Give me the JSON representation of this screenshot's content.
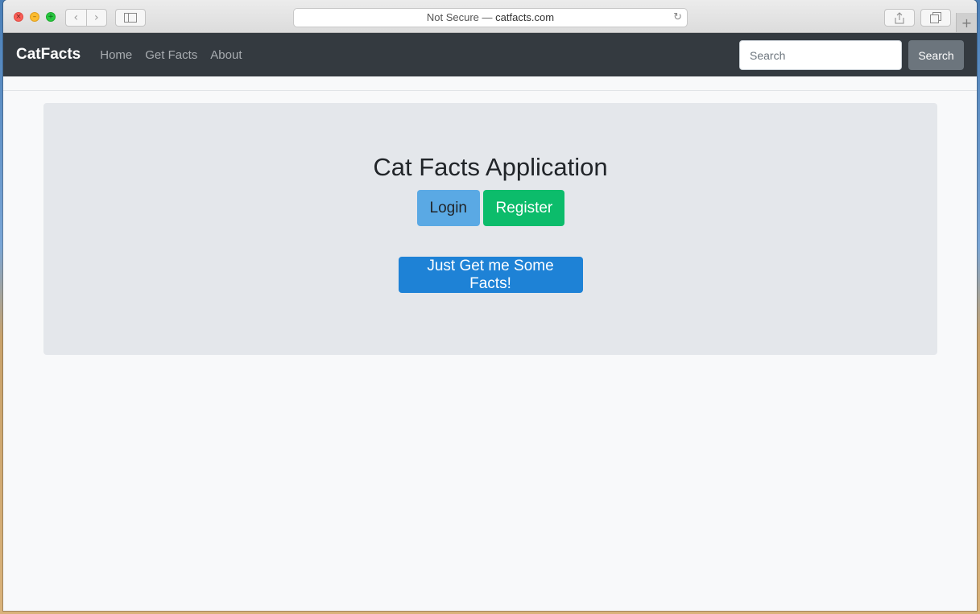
{
  "browser": {
    "address_prefix": "Not Secure — ",
    "address_domain": "catfacts.com"
  },
  "navbar": {
    "brand": "CatFacts",
    "links": [
      {
        "label": "Home"
      },
      {
        "label": "Get Facts"
      },
      {
        "label": "About"
      }
    ],
    "search_placeholder": "Search",
    "search_button": "Search"
  },
  "jumbotron": {
    "title": "Cat Facts Application",
    "login_label": "Login",
    "register_label": "Register",
    "facts_label": "Just Get me Some Facts!"
  },
  "colors": {
    "navbar_bg": "#343a40",
    "login": "#5aa9e4",
    "register": "#0cbc6b",
    "facts": "#1e82d6",
    "jumbotron_bg": "#e4e7eb"
  }
}
